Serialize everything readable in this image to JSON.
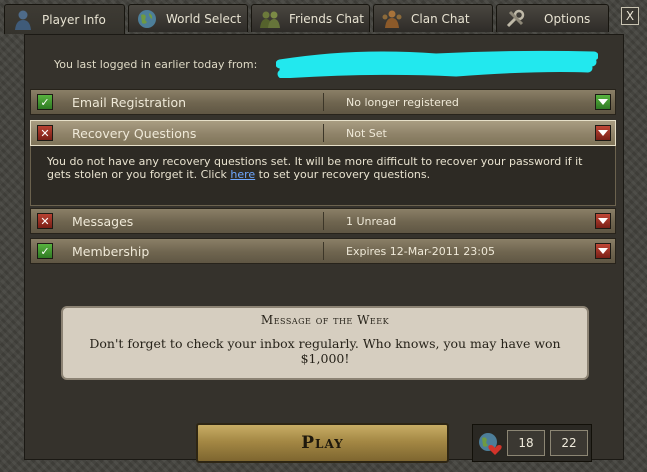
{
  "tabs": [
    {
      "label": "Player Info",
      "icon": "player-icon",
      "active": true
    },
    {
      "label": "World Select",
      "icon": "globe-icon",
      "active": false
    },
    {
      "label": "Friends Chat",
      "icon": "friends-icon",
      "active": false
    },
    {
      "label": "Clan Chat",
      "icon": "clan-icon",
      "active": false
    },
    {
      "label": "Options",
      "icon": "tools-icon",
      "active": false
    }
  ],
  "close_label": "X",
  "last_login_text": "You last logged in earlier today from:",
  "rows": [
    {
      "label": "Email Registration",
      "value": "No longer registered",
      "status": "ok"
    },
    {
      "label": "Recovery Questions",
      "value": "Not Set",
      "status": "bad"
    },
    {
      "label": "Messages",
      "value": "1 Unread",
      "status": "bad"
    },
    {
      "label": "Membership",
      "value": "Expires 12-Mar-2011 23:05",
      "status": "ok"
    }
  ],
  "recovery_notice": {
    "before_link": "You do not have any recovery questions set. It will be more difficult to recover your password if it gets stolen or you forget it. Click ",
    "link": "here",
    "after_link": " to set your recovery questions."
  },
  "message_of_week": {
    "title": "Message of the Week",
    "text": "Don't forget to check your inbox regularly.  Who knows, you may have won $1,000!"
  },
  "play_label": "Play",
  "world": {
    "icon": "world-heart-icon",
    "current": "18",
    "other": "22"
  },
  "colors": {
    "ok": "#3f9a2f",
    "bad": "#a6322a",
    "link": "#6fa8ff",
    "redaction": "#22e8ee"
  }
}
